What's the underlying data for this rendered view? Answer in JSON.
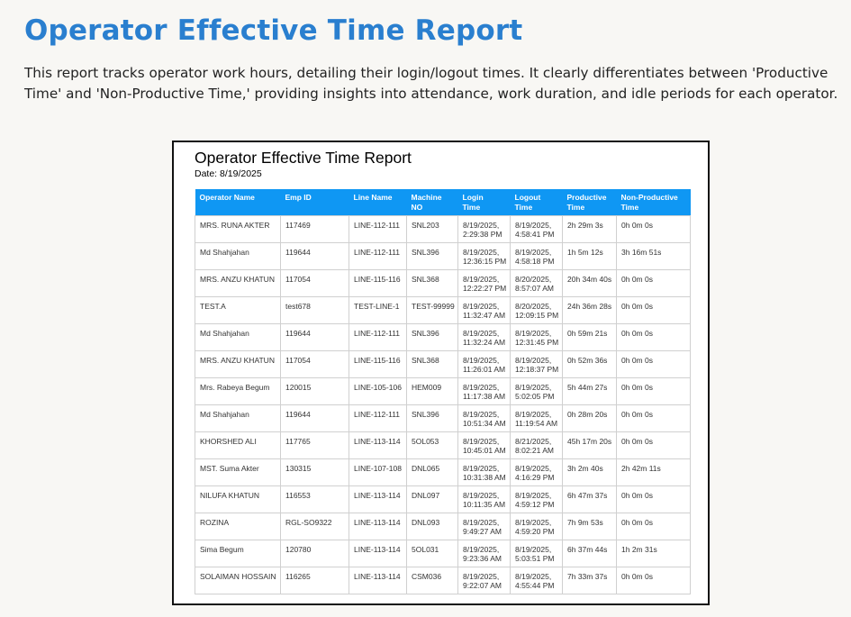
{
  "page": {
    "title": "Operator Effective Time Report",
    "description": "This report tracks operator work hours, detailing their login/logout times. It clearly differentiates between 'Productive Time' and 'Non-Productive Time,' providing insights into attendance, work duration, and idle periods for each operator."
  },
  "report": {
    "title": "Operator Effective Time Report",
    "date": "Date: 8/19/2025",
    "columns": [
      [
        "Operator Name"
      ],
      [
        "Emp ID"
      ],
      [
        "Line Name"
      ],
      [
        "Machine",
        "NO"
      ],
      [
        "Login",
        "Time"
      ],
      [
        "Logout",
        "Time"
      ],
      [
        "Productive",
        "Time"
      ],
      [
        "Non-Productive",
        "Time"
      ]
    ],
    "rows": [
      [
        [
          "MRS. RUNA AKTER"
        ],
        [
          "117469"
        ],
        [
          "LINE-112-111"
        ],
        [
          "SNL203"
        ],
        [
          "8/19/2025,",
          "2:29:38 PM"
        ],
        [
          "8/19/2025,",
          "4:58:41 PM"
        ],
        [
          "2h 29m 3s"
        ],
        [
          "0h 0m 0s"
        ]
      ],
      [
        [
          "Md Shahjahan"
        ],
        [
          "119644"
        ],
        [
          "LINE-112-111"
        ],
        [
          "SNL396"
        ],
        [
          "8/19/2025,",
          "12:36:15 PM"
        ],
        [
          "8/19/2025,",
          "4:58:18 PM"
        ],
        [
          "1h 5m 12s"
        ],
        [
          "3h 16m 51s"
        ]
      ],
      [
        [
          "MRS. ANZU KHATUN"
        ],
        [
          "117054"
        ],
        [
          "LINE-115-116"
        ],
        [
          "SNL368"
        ],
        [
          "8/19/2025,",
          "12:22:27 PM"
        ],
        [
          "8/20/2025,",
          "8:57:07 AM"
        ],
        [
          "20h 34m 40s"
        ],
        [
          "0h 0m 0s"
        ]
      ],
      [
        [
          "TEST.A"
        ],
        [
          "test678"
        ],
        [
          "TEST-LINE-1"
        ],
        [
          "TEST-99999"
        ],
        [
          "8/19/2025,",
          "11:32:47 AM"
        ],
        [
          "8/20/2025,",
          "12:09:15 PM"
        ],
        [
          "24h 36m 28s"
        ],
        [
          "0h 0m 0s"
        ]
      ],
      [
        [
          "Md Shahjahan"
        ],
        [
          "119644"
        ],
        [
          "LINE-112-111"
        ],
        [
          "SNL396"
        ],
        [
          "8/19/2025,",
          "11:32:24 AM"
        ],
        [
          "8/19/2025,",
          "12:31:45 PM"
        ],
        [
          "0h 59m 21s"
        ],
        [
          "0h 0m 0s"
        ]
      ],
      [
        [
          "MRS. ANZU KHATUN"
        ],
        [
          "117054"
        ],
        [
          "LINE-115-116"
        ],
        [
          "SNL368"
        ],
        [
          "8/19/2025,",
          "11:26:01 AM"
        ],
        [
          "8/19/2025,",
          "12:18:37 PM"
        ],
        [
          "0h 52m 36s"
        ],
        [
          "0h 0m 0s"
        ]
      ],
      [
        [
          "Mrs. Rabeya Begum"
        ],
        [
          "120015"
        ],
        [
          "LINE-105-106"
        ],
        [
          "HEM009"
        ],
        [
          "8/19/2025,",
          "11:17:38 AM"
        ],
        [
          "8/19/2025,",
          "5:02:05 PM"
        ],
        [
          "5h 44m 27s"
        ],
        [
          "0h 0m 0s"
        ]
      ],
      [
        [
          "Md Shahjahan"
        ],
        [
          "119644"
        ],
        [
          "LINE-112-111"
        ],
        [
          "SNL396"
        ],
        [
          "8/19/2025,",
          "10:51:34 AM"
        ],
        [
          "8/19/2025,",
          "11:19:54 AM"
        ],
        [
          "0h 28m 20s"
        ],
        [
          "0h 0m 0s"
        ]
      ],
      [
        [
          "KHORSHED ALI"
        ],
        [
          "117765"
        ],
        [
          "LINE-113-114"
        ],
        [
          "5OL053"
        ],
        [
          "8/19/2025,",
          "10:45:01 AM"
        ],
        [
          "8/21/2025,",
          "8:02:21 AM"
        ],
        [
          "45h 17m 20s"
        ],
        [
          "0h 0m 0s"
        ]
      ],
      [
        [
          "MST. Suma Akter"
        ],
        [
          "130315"
        ],
        [
          "LINE-107-108"
        ],
        [
          "DNL065"
        ],
        [
          "8/19/2025,",
          "10:31:38 AM"
        ],
        [
          "8/19/2025,",
          "4:16:29 PM"
        ],
        [
          "3h 2m 40s"
        ],
        [
          "2h 42m 11s"
        ]
      ],
      [
        [
          "NILUFA KHATUN"
        ],
        [
          "116553"
        ],
        [
          "LINE-113-114"
        ],
        [
          "DNL097"
        ],
        [
          "8/19/2025,",
          "10:11:35 AM"
        ],
        [
          "8/19/2025,",
          "4:59:12 PM"
        ],
        [
          "6h 47m 37s"
        ],
        [
          "0h 0m 0s"
        ]
      ],
      [
        [
          "ROZINA"
        ],
        [
          "RGL-SO9322"
        ],
        [
          "LINE-113-114"
        ],
        [
          "DNL093"
        ],
        [
          "8/19/2025,",
          "9:49:27 AM"
        ],
        [
          "8/19/2025,",
          "4:59:20 PM"
        ],
        [
          "7h 9m 53s"
        ],
        [
          "0h 0m 0s"
        ]
      ],
      [
        [
          "Sima Begum"
        ],
        [
          "120780"
        ],
        [
          "LINE-113-114"
        ],
        [
          "5OL031"
        ],
        [
          "8/19/2025,",
          "9:23:36 AM"
        ],
        [
          "8/19/2025,",
          "5:03:51 PM"
        ],
        [
          "6h 37m 44s"
        ],
        [
          "1h 2m 31s"
        ]
      ],
      [
        [
          "SOLAIMAN HOSSAIN"
        ],
        [
          "116265"
        ],
        [
          "LINE-113-114"
        ],
        [
          "CSM036"
        ],
        [
          "8/19/2025,",
          "9:22:07 AM"
        ],
        [
          "8/19/2025,",
          "4:55:44 PM"
        ],
        [
          "7h 33m 37s"
        ],
        [
          "0h 0m 0s"
        ]
      ]
    ]
  }
}
